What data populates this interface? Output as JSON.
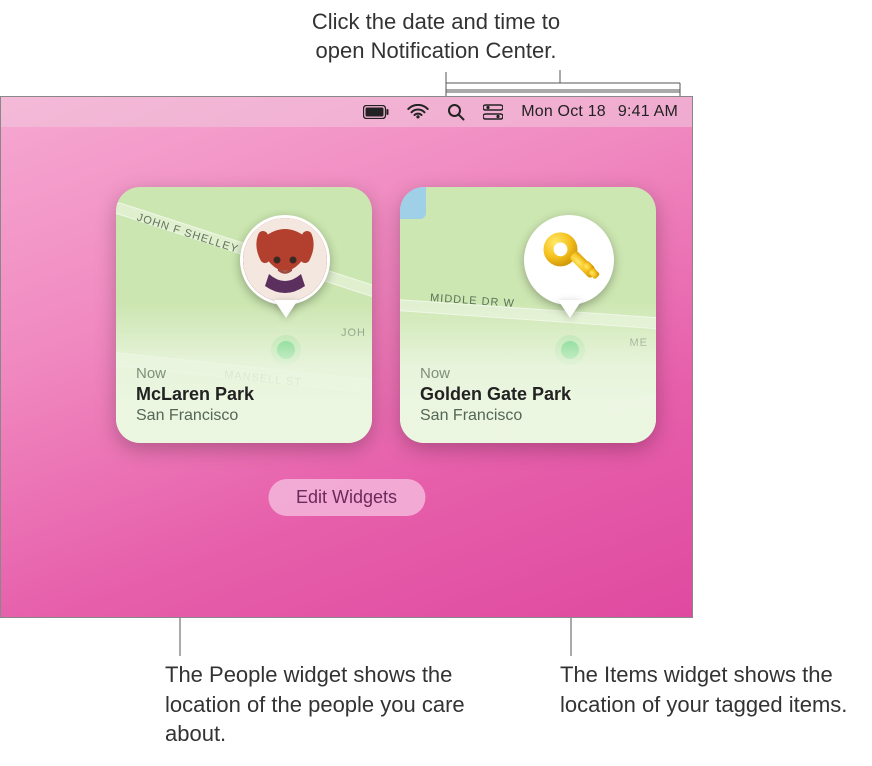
{
  "callouts": {
    "top_line1": "Click the date and time to",
    "top_line2": "open Notification Center.",
    "bottom_left": "The People widget shows the location of the people you care about.",
    "bottom_right": "The Items widget shows the location of your tagged items."
  },
  "menubar": {
    "battery_icon": "battery-icon",
    "wifi_icon": "wifi-icon",
    "search_icon": "search-icon",
    "control_center_icon": "control-center-icon",
    "date": "Mon Oct 18",
    "time": "9:41 AM"
  },
  "widgets": {
    "people": {
      "now_label": "Now",
      "location_title": "McLaren Park",
      "location_subtitle": "San Francisco",
      "road1": "JOHN F SHELLEY DR",
      "road1b": "JOH",
      "road2": "MANSELL ST"
    },
    "items": {
      "now_label": "Now",
      "location_title": "Golden Gate Park",
      "location_subtitle": "San Francisco",
      "road1": "MIDDLE DR W",
      "road2": "ME"
    },
    "edit_button_label": "Edit Widgets"
  }
}
